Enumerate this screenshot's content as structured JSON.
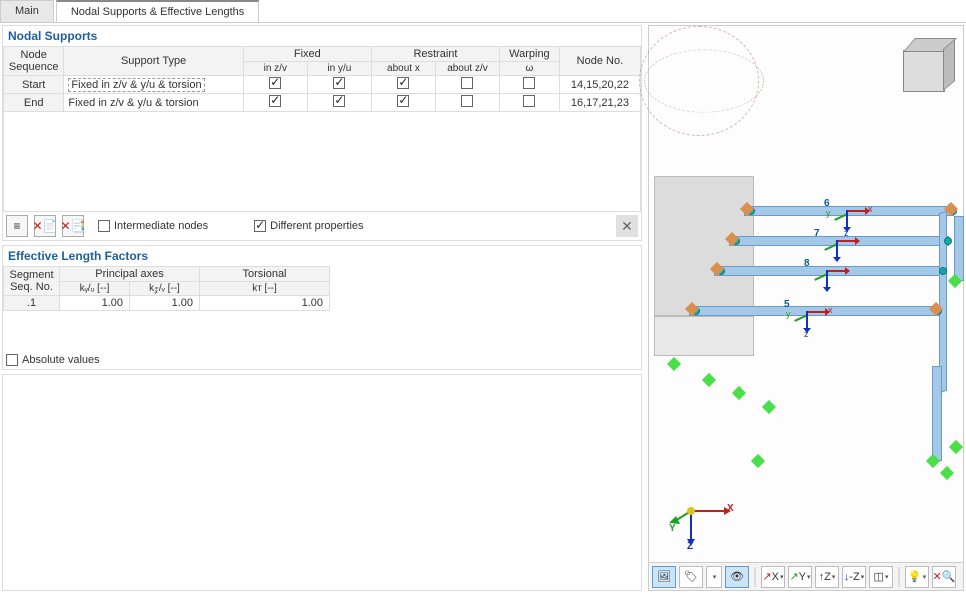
{
  "tabs": {
    "main": "Main",
    "nodal": "Nodal Supports & Effective Lengths"
  },
  "sections": {
    "nodal_supports": "Nodal Supports",
    "eff_len": "Effective Length Factors"
  },
  "ns_table": {
    "headers": {
      "node_seq": "Node Sequence",
      "support_type": "Support Type",
      "fixed": "Fixed",
      "restraint": "Restraint",
      "warping": "Warping",
      "node_no": "Node No.",
      "in_zv": "in z/v",
      "in_yu": "in y/u",
      "about_x": "about x",
      "about_zv": "about z/v",
      "omega": "ω"
    },
    "rows": [
      {
        "seq": "Start",
        "type": "Fixed in z/v & y/u & torsion",
        "zv": true,
        "yu": true,
        "ax": true,
        "azv": false,
        "w": false,
        "nodes": "14,15,20,22"
      },
      {
        "seq": "End",
        "type": "Fixed in z/v & y/u & torsion",
        "zv": true,
        "yu": true,
        "ax": true,
        "azv": false,
        "w": false,
        "nodes": "16,17,21,23"
      }
    ]
  },
  "toolbar": {
    "intermediate": "Intermediate nodes",
    "different_props": "Different properties"
  },
  "elf_table": {
    "headers": {
      "seg": "Segment Seq. No.",
      "principal": "Principal axes",
      "torsional": "Torsional",
      "kyu": "kᵧ/ᵤ [--]",
      "kzv": "k𝓏/ᵥ [--]",
      "kt": "kᴛ [--]"
    },
    "rows": [
      {
        "seg": ".1",
        "kyu": "1.00",
        "kzv": "1.00",
        "kt": "1.00"
      }
    ]
  },
  "absolute_values": "Absolute values",
  "viewport": {
    "axis": {
      "x": "X",
      "y": "Y",
      "z": "Z",
      "xl": "x",
      "yl": "y",
      "zl": "z"
    },
    "members": {
      "m5": "5",
      "m6": "6",
      "m7": "7",
      "m8": "8"
    }
  },
  "bottom_icons": {
    "view3d": "🖼",
    "cam": "🏷",
    "down": "▾",
    "eye": "👁",
    "ax_x": "X",
    "ax_y": "Y",
    "ax_z": "Z",
    "ax_nz": "-Z",
    "cube": "◫",
    "bulb": "💡",
    "mag": "🔍"
  }
}
